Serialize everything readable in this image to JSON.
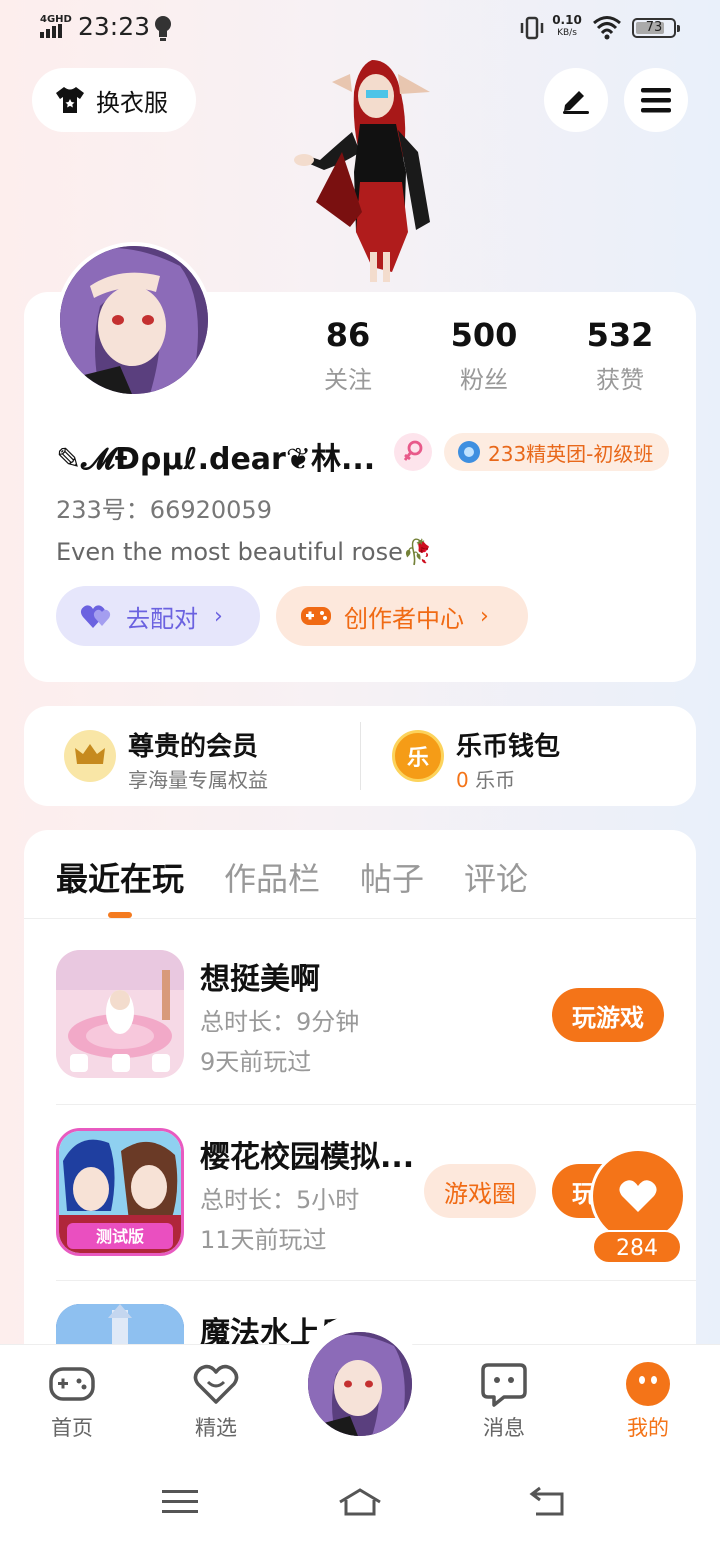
{
  "status": {
    "network": "4GHD",
    "time": "23:23",
    "speed_value": "0.10",
    "speed_unit": "KB/s",
    "battery": "73"
  },
  "header": {
    "outfit_label": "换衣服",
    "edit_icon": "pencil-icon",
    "menu_icon": "hamburger-menu-icon"
  },
  "profile": {
    "stats": [
      {
        "value": "86",
        "label": "关注"
      },
      {
        "value": "500",
        "label": "粉丝"
      },
      {
        "value": "532",
        "label": "获赞"
      }
    ],
    "username": "✎𝓜Ɖρμℓ.dear❦林...",
    "gender": "female",
    "rank_badge": "233精英团-初级班",
    "account_id": "233号：66920059",
    "bio": "Even the most beautiful rose🥀",
    "match_label": "去配对",
    "creator_label": "创作者中心"
  },
  "perks": {
    "vip_title": "尊贵的会员",
    "vip_sub": "享海量专属权益",
    "wallet_title": "乐币钱包",
    "wallet_icon_text": "乐",
    "wallet_amount": "0",
    "wallet_unit": "乐币"
  },
  "tabs": [
    {
      "label": "最近在玩",
      "active": true
    },
    {
      "label": "作品栏",
      "active": false
    },
    {
      "label": "帖子",
      "active": false
    },
    {
      "label": "评论",
      "active": false
    }
  ],
  "games": [
    {
      "title": "想挺美啊",
      "time": "总时长：9分钟",
      "last": "9天前玩过",
      "play": "玩游戏"
    },
    {
      "title": "樱花校园模拟...",
      "time": "总时长：5小时",
      "last": "11天前玩过",
      "circle": "游戏圈",
      "play": "玩",
      "icon_text": "测试版"
    },
    {
      "title": "魔法水上乐"
    }
  ],
  "like_float": {
    "count": "284"
  },
  "bottom_nav": [
    {
      "label": "首页",
      "icon": "gamepad-icon"
    },
    {
      "label": "精选",
      "icon": "heart-chat-icon"
    },
    {
      "label": "消息",
      "icon": "message-icon"
    },
    {
      "label": "我的",
      "icon": "profile-dots-icon",
      "active": true
    }
  ],
  "colors": {
    "accent": "#f47418",
    "match": "#6b62e0",
    "muted": "#999999"
  }
}
